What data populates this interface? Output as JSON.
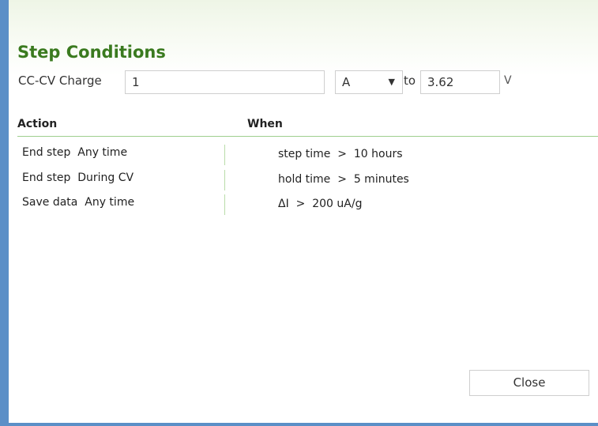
{
  "dialog": {
    "title": "Step Conditions",
    "mode_label": "CC-CV Charge",
    "amount_value": "1",
    "unit_value": "A",
    "to_label": "to",
    "voltage_value": "3.62",
    "voltage_unit": "V"
  },
  "table": {
    "headers": {
      "action": "Action",
      "when": "When"
    },
    "rows": [
      {
        "action": "End step  Any time",
        "condition": "step time  >  10 hours"
      },
      {
        "action": "End step  During CV",
        "condition": "hold time  >  5 minutes"
      },
      {
        "action": "Save data  Any time",
        "condition": "ΔI  >  200 uA/g"
      }
    ]
  },
  "buttons": {
    "close_label": "Close"
  },
  "colors": {
    "title": "#3a7a1f",
    "frame": "#5b8fc7",
    "divider": "#9fcf8f"
  }
}
